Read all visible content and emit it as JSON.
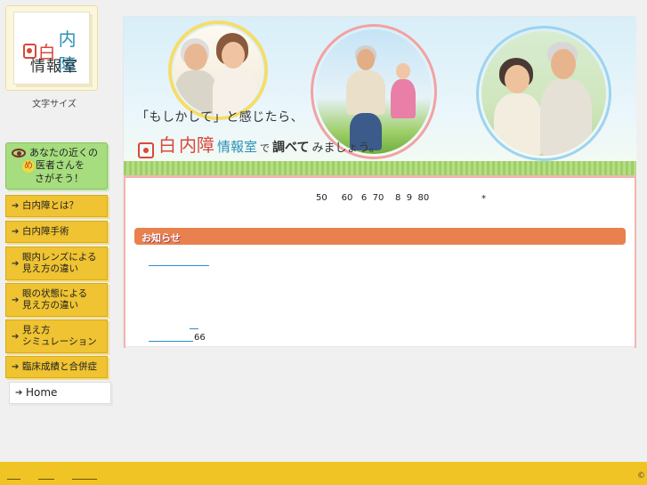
{
  "logo": {
    "title_red": "白",
    "title_blue": "内障",
    "subtitle": "情報室"
  },
  "sidebar": {
    "font_size_label": "文字サイズ",
    "doctor_search": {
      "line1": "あなたの近くの",
      "badge": "め",
      "line2": "医者さんを",
      "line3": "さがそう！"
    },
    "nav_arrow": "➔",
    "items": [
      {
        "label": "白内障とは？",
        "lines": 1
      },
      {
        "label": "白内障手術",
        "lines": 1
      },
      {
        "label": "眼内レンズによる見え方の違い",
        "line1": "眼内レンズによる",
        "line2": "見え方の違い",
        "lines": 2
      },
      {
        "label": "眼の状態による見え方の違い",
        "line1": "眼の状態による",
        "line2": "見え方の違い",
        "lines": 2
      },
      {
        "label": "見え方シミュレーション",
        "line1": "見え方",
        "line2": "シミュレーション",
        "lines": 2
      },
      {
        "label": "臨床成績と合併症",
        "lines": 1
      }
    ],
    "home_label": "Home"
  },
  "banner": {
    "catch_line1": "「もしかして」と感じたら、",
    "catch_red": "白",
    "catch_red2": "内障",
    "catch_blue": "情報室",
    "catch_de": "で",
    "catch_bold": "調べて",
    "catch_rest": "みましょう。"
  },
  "content": {
    "ages_text": "50     60   6  70    8  9  80",
    "ages_star": "*",
    "news_label": "お知らせ",
    "number_66": "66"
  },
  "footer": {
    "copyright": "©"
  },
  "colors": {
    "accent_orange": "#e8814e",
    "nav_yellow": "#efc332",
    "doctor_green": "#a6dd7e",
    "brand_red": "#d9483b",
    "brand_blue": "#2a92b8",
    "footer_yellow": "#f0c424",
    "link_blue": "#2a8fd0"
  }
}
